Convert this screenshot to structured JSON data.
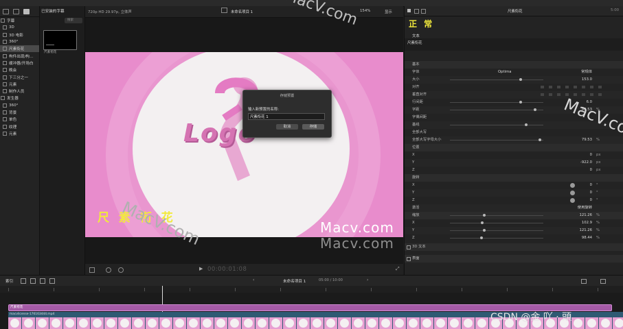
{
  "top": {
    "watermark": "MacV.com"
  },
  "sidebar": {
    "items": [
      {
        "label": "字幕",
        "level": 0
      },
      {
        "label": "3D",
        "level": 1
      },
      {
        "label": "3D 电影",
        "level": 1
      },
      {
        "label": "360°",
        "level": 1
      },
      {
        "label": "尺素衔花",
        "level": 1,
        "selected": true
      },
      {
        "label": "构件出现/构…",
        "level": 1
      },
      {
        "label": "缓冲器/开场白",
        "level": 1
      },
      {
        "label": "晚会",
        "level": 1
      },
      {
        "label": "下三分之一",
        "level": 1
      },
      {
        "label": "元素",
        "level": 1
      },
      {
        "label": "制作人员",
        "level": 1
      },
      {
        "label": "发生器",
        "level": 0
      },
      {
        "label": "360°",
        "level": 1
      },
      {
        "label": "背景",
        "level": 1
      },
      {
        "label": "单色",
        "level": 1
      },
      {
        "label": "纹理",
        "level": 1
      },
      {
        "label": "元素",
        "level": 1
      }
    ]
  },
  "browser": {
    "title": "已安装的字幕",
    "search_placeholder": "搜索",
    "thumb_label": "尺素衔花"
  },
  "viewer": {
    "format": "720p HD 29.97p, 立体声",
    "project": "未命名项目 1",
    "zoom": "154%",
    "display": "显示",
    "timecode": "00:00:01:08",
    "canvas_title_text": "尺 素 衔 花",
    "logo_text": "Logo"
  },
  "dialog": {
    "title": "存储预置",
    "prompt": "输入新预置的名称:",
    "value": "尺素衔花 1",
    "cancel": "取消",
    "save": "存储"
  },
  "inspector": {
    "title": "尺素衔花",
    "time": "5:00",
    "preview_text": "正 常",
    "text_header": "文本",
    "text_value": "尺素衔花",
    "basic": "基本",
    "font_label": "字体",
    "font_name": "Optima",
    "font_style": "常规体",
    "size_label": "大小",
    "size_value": "153.0",
    "align_label": "对齐",
    "valign_label": "垂直对齐",
    "line_spacing_label": "行间距",
    "line_spacing_value": "6.0",
    "tracking_label": "字距",
    "tracking_value": "89.53",
    "tracking_unit": "%",
    "kerning_label": "字偶间距",
    "baseline_label": "基线",
    "allcaps_label": "全部大写",
    "allcaps_size_label": "全部大写字母大小",
    "allcaps_size_value": "79.53",
    "allcaps_size_unit": "%",
    "position": "位置",
    "pos_x_label": "X",
    "pos_x_value": "0",
    "pos_y_label": "Y",
    "pos_y_value": "-922.0",
    "pos_z_label": "Z",
    "pos_z_value": "0",
    "px": "px",
    "rotation": "旋转",
    "rot_x_label": "X",
    "rot_x_value": "0",
    "rot_y_label": "Y",
    "rot_y_value": "0",
    "rot_z_label": "Z",
    "rot_z_value": "0",
    "deg": "°",
    "animate_label": "激活",
    "animate_value": "使用旋转",
    "scale_label": "缩放",
    "scale_value": "121.26",
    "scale_x_label": "X",
    "scale_x_value": "102.9",
    "scale_y_label": "Y",
    "scale_y_value": "121.26",
    "scale_z_label": "Z",
    "scale_z_value": "98.44",
    "pct": "%",
    "text3d_label": "3D 文本",
    "face_label": "表面"
  },
  "timeline": {
    "index": "索引",
    "project": "未命名项目 1",
    "duration": "05:00 / 10:00",
    "clip_title": "尺素衔花",
    "clip_video": "macvlicense-176163444.mp4",
    "csdn": "CSDN @金 吖 · 頭"
  },
  "watermarks": {
    "a": "MacV.com",
    "b": "Macv.com",
    "c": "Macv.com",
    "d": "MacV.com"
  },
  "colors": {
    "canvas_pink": "#e88ccc",
    "ribbon": "#e06db6",
    "title_yellow": "#f2ea3c",
    "clip_purple": "#a45aa6"
  }
}
